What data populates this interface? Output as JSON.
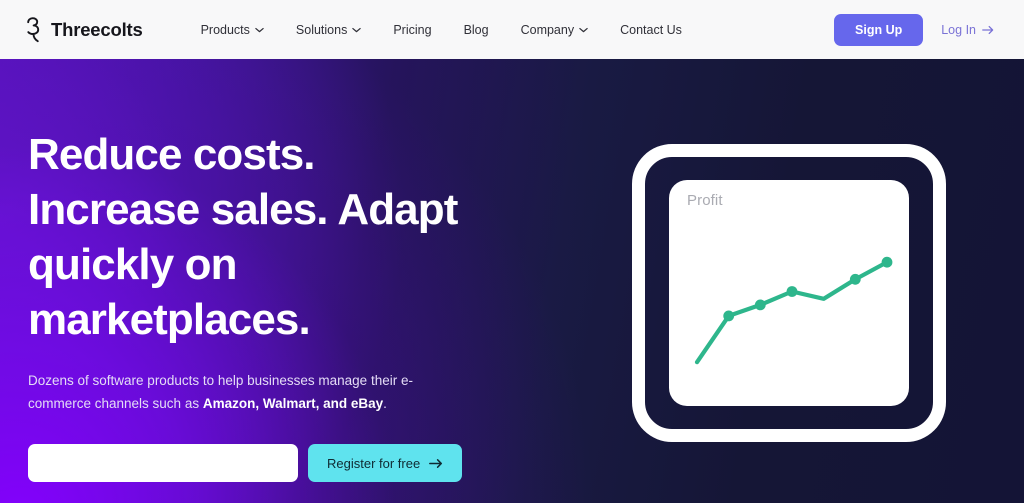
{
  "navbar": {
    "brand": {
      "name": "Threecolts",
      "logo_icon": "threecolts-swan-logo"
    },
    "links": [
      {
        "label": "Products",
        "has_dropdown": true
      },
      {
        "label": "Solutions",
        "has_dropdown": true
      },
      {
        "label": "Pricing",
        "has_dropdown": false
      },
      {
        "label": "Blog",
        "has_dropdown": false
      },
      {
        "label": "Company",
        "has_dropdown": true
      },
      {
        "label": "Contact Us",
        "has_dropdown": false
      }
    ],
    "signup_label": "Sign Up",
    "login_label": "Log In",
    "signup_color": "#6667ec",
    "login_color": "#7a72d6",
    "background_color": "#f8f8f9"
  },
  "hero": {
    "headline_lines": [
      "Reduce costs.",
      "Increase sales. Adapt",
      "quickly on",
      "marketplaces."
    ],
    "subtext": {
      "part1": "Dozens of software products to help businesses manage their e-commerce channels such as ",
      "emphasis": "Amazon, Walmart, and eBay",
      "part2": "."
    },
    "email_input_value": "",
    "email_input_placeholder": "",
    "register_label": "Register for free",
    "register_color": "#5fe3ee",
    "gradient_from": "#8500ff",
    "gradient_to": "#141436"
  },
  "chart_data": {
    "type": "line",
    "title": "Profit",
    "xlabel": "",
    "ylabel": "",
    "x": [
      0,
      1,
      2,
      3,
      4,
      5,
      6
    ],
    "values": [
      8,
      46,
      55,
      66,
      60,
      76,
      90
    ],
    "point_markers": [
      false,
      true,
      true,
      true,
      false,
      true,
      true
    ],
    "series": [
      {
        "name": "Profit",
        "values": [
          8,
          46,
          55,
          66,
          60,
          76,
          90
        ]
      }
    ],
    "xlim": [
      0,
      6
    ],
    "ylim": [
      0,
      100
    ],
    "grid": false,
    "legend": "none",
    "line_color": "#2eb68c",
    "marker_color": "#2eb68c",
    "title_color": "#aaabb2",
    "background_color": "#ffffff"
  }
}
